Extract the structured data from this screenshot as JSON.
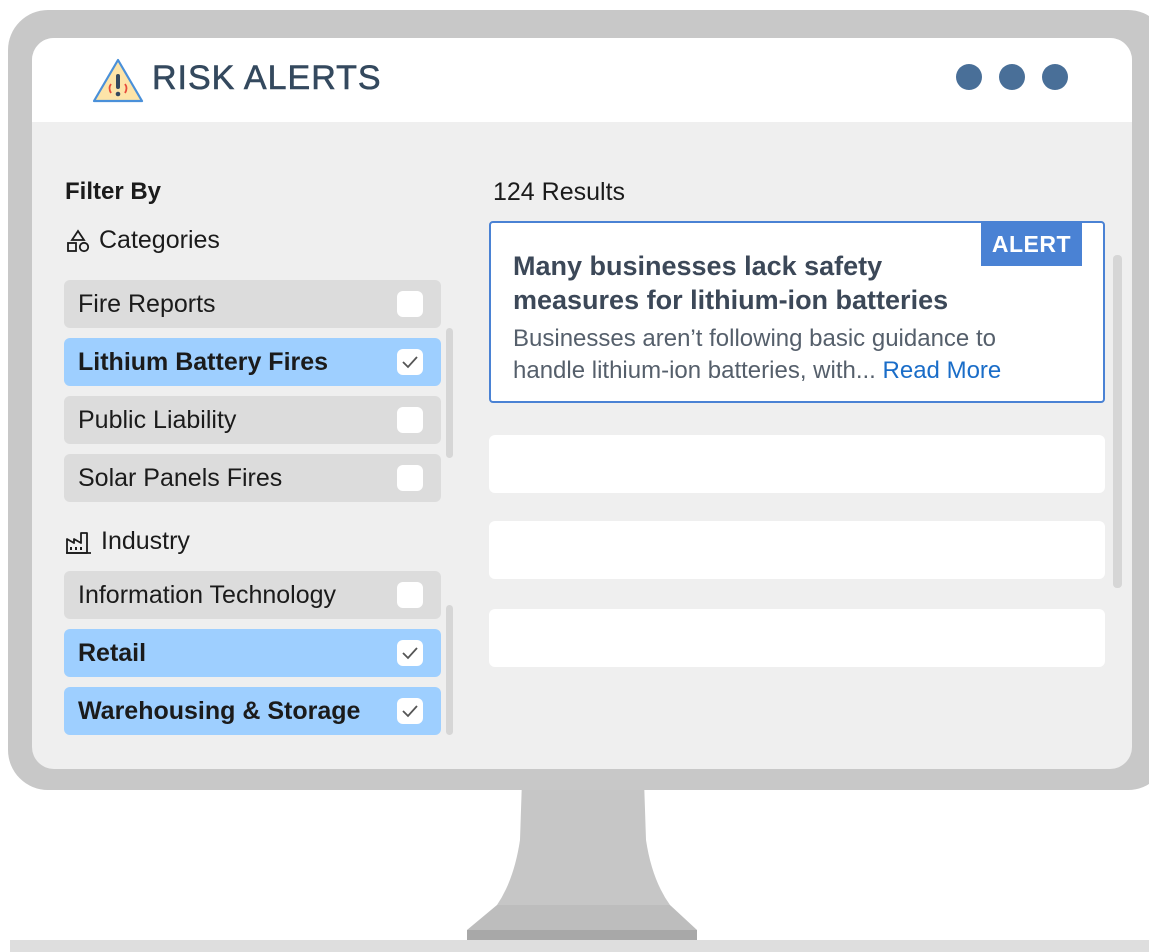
{
  "app": {
    "title": "RISK ALERTS"
  },
  "icons": {
    "logo": "warning-signal-icon",
    "categories": "shapes-icon",
    "industry": "factory-icon",
    "check": "check-icon"
  },
  "colors": {
    "accent": "#4a82d4",
    "selected": "#9ecfff",
    "window_dots": "#496f98",
    "link": "#1a6dc8"
  },
  "sidebar": {
    "filter_title": "Filter By",
    "categories": {
      "heading": "Categories",
      "items": [
        {
          "label": "Fire Reports",
          "checked": false
        },
        {
          "label": "Lithium Battery Fires",
          "checked": true
        },
        {
          "label": "Public Liability",
          "checked": false
        },
        {
          "label": "Solar Panels Fires",
          "checked": false
        }
      ]
    },
    "industry": {
      "heading": "Industry",
      "items": [
        {
          "label": "Information Technology",
          "checked": false
        },
        {
          "label": "Retail",
          "checked": true
        },
        {
          "label": "Warehousing & Storage",
          "checked": true
        }
      ]
    }
  },
  "results": {
    "count_label": "124 Results",
    "featured": {
      "badge": "ALERT",
      "title": "Many businesses lack safety measures for lithium-ion batteries",
      "snippet": "Businesses aren’t following basic guidance to handle lithium-ion batteries, with...",
      "read_more": "Read More"
    }
  }
}
